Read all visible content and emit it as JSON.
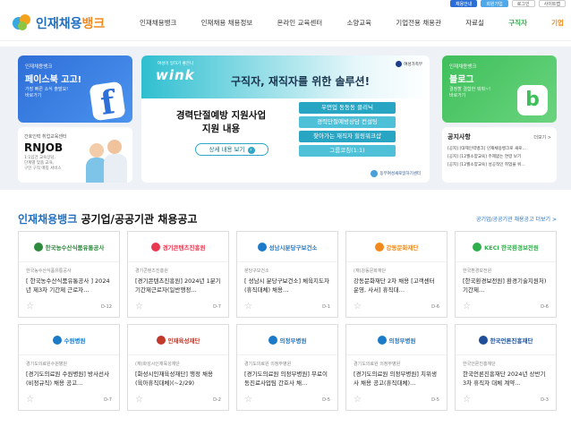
{
  "utility": {
    "btn1": "채용안내",
    "btn2": "회원가입",
    "btn3": "로그인",
    "btn4": "사이트맵"
  },
  "header": {
    "logo_main": "인재채용",
    "logo_sub": "뱅크",
    "nav": [
      "인재채용뱅크",
      "인재채용 채용정보",
      "온라인 교육센터",
      "소양교육",
      "기업전용 채용관",
      "자료실",
      "구직자",
      "기업"
    ]
  },
  "hero": {
    "facebook": {
      "small": "인재채용뱅크",
      "title": "페이스북 고고!",
      "sub1": "가장 빠른 소식 출발요!",
      "sub2": "바로가기",
      "icon": "facebook-icon"
    },
    "rnjob": {
      "small": "간호인력 취업교육센터",
      "title": "RNJOB",
      "sub1": "1:1입건 교육상담,",
      "sub2": "단계별 맞춤 교육,",
      "sub3": "구인 구직 매칭 서비스"
    },
    "wink": {
      "tag": "여성이 일하기 좋은나",
      "logo": "wink",
      "title": "구직자, 재직자를 위한 솔루션!",
      "seal": "여성가족부",
      "heading1": "경력단절예방 지원사업",
      "heading2": "지원 내용",
      "detail_btn": "상세 내용 보기",
      "pills": [
        "우먼업 동동동 클리닉",
        "경력단절예방상담 컨설팅",
        "찾아가는 재직자 힐링워크샵",
        "그룹코칭(1:1)"
      ],
      "org": "동부여성새로일하기센터"
    },
    "blog": {
      "small": "인재채용뱅크",
      "title": "블로그",
      "sub1": "결정할 결합한 뭐뭐~!",
      "sub2": "바로가기",
      "icon": "b"
    },
    "notice": {
      "title": "공지사항",
      "more": "더보기 >",
      "items": [
        "[공지] [대제인력뱅크] 인재채용뱅크로 새로…",
        "[공지] [12월소양교육] 주제없는 연령 보기",
        "[공지] [12월소양교육] 성공적인 취업을 위…"
      ]
    }
  },
  "jobs": {
    "section_accent": "인재채용뱅크",
    "section_title": "공기업/공공기관 채용공고",
    "more": "공기업/공공기관 채용공고 더보기 >",
    "items": [
      {
        "logo": "한국농수산식품유통공사",
        "org": "한국농수산식품유통공사",
        "title": "[ 한국농수산식품유통공사 ] 2024년 제3차 기간제 근로자…",
        "dday": "D-12",
        "color": "#2e8b3e"
      },
      {
        "logo": "경기콘텐츠진흥원",
        "org": "경기콘텐츠진흥원",
        "title": "[경기콘텐츠진흥원] 2024년 1분기 기간제근로자(일반행정…",
        "dday": "D-7",
        "color": "#e8384f"
      },
      {
        "logo": "성남시분당구보건소",
        "org": "분당구보건소",
        "title": "[ 성남시 분당구보건소] 체육지도자(휴직대체) 채용…",
        "dday": "D-1",
        "color": "#1c7bc9"
      },
      {
        "logo": "강동문화재단",
        "org": "(재)강동문화재단",
        "title": "강동문화재단 2차 채용 [고객센터 운영, 사서] 휴직대…",
        "dday": "D-6",
        "color": "#f08a1c"
      },
      {
        "logo": "KECI 한국환경보전원",
        "org": "한국환경보전원",
        "title": "[한국환경보전원] 환경기술지원처) 기간제…",
        "dday": "D-6",
        "color": "#2fae4c"
      },
      {
        "logo": "수원병원",
        "org": "경기도의료원수원병원",
        "title": "[경기도의료원 수원병원] 방사선사(비정규직) 채용 공고…",
        "dday": "D-7",
        "color": "#1c7bc9"
      },
      {
        "logo": "인재육성재단",
        "org": "(재)화성시인재육성재단",
        "title": "[화성시인재육성재단] 행정 채용 (육아휴직대체)(~2/29)",
        "dday": "D-2",
        "color": "#c0392b"
      },
      {
        "logo": "의정부병원",
        "org": "경기도의료원 의정부병원",
        "title": "[경기도의료원 의정부병원] 무료이동진료사업팀 간호사 채…",
        "dday": "D-5",
        "color": "#1c7bc9"
      },
      {
        "logo": "의정부병원",
        "org": "경기도의료원 의정부병원",
        "title": "[경기도의료원 의정부병원] 치위생사 채용 공고(휴직대체)…",
        "dday": "D-5",
        "color": "#1c7bc9"
      },
      {
        "logo": "한국언론진흥재단",
        "org": "한국언론진흥재단",
        "title": "한국언론진흥재단 2024년 상반기 3차 휴직자 대체 계약…",
        "dday": "D-3",
        "color": "#1f4f9a"
      }
    ]
  }
}
